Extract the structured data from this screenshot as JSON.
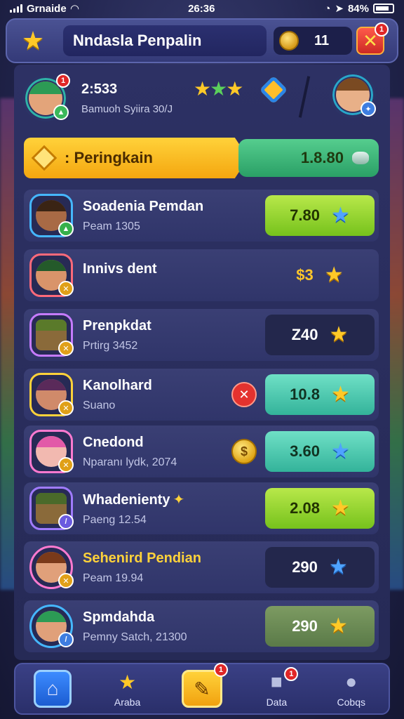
{
  "status_bar": {
    "carrier": "Grnaide",
    "time": "26:36",
    "battery_text": "84%"
  },
  "header": {
    "title": "Nndasla Penpalin",
    "coin_count": "11",
    "close_badge": "1"
  },
  "match": {
    "player_badge": "1",
    "time": "2:533",
    "subtitle": "Bamuoh Syiira 30/J",
    "stars": "★★★"
  },
  "ranking": {
    "label": ": Peringkain",
    "value": "1.8.80"
  },
  "list": [
    {
      "name": "Soadenia Pemdan",
      "sub": "Peam 1305",
      "score": "7.80",
      "star": "blue",
      "style": "green"
    },
    {
      "name": "Innivs dent",
      "sub": "",
      "score": "$3",
      "star": "gold",
      "style": "plain"
    },
    {
      "name": "Prenpkdat",
      "sub": "Prtirg 3452",
      "score": "Z40",
      "star": "gold",
      "style": "dark"
    },
    {
      "name": "Kanolhard",
      "sub": "Suano",
      "score": "10.8",
      "star": "gold",
      "style": "teal"
    },
    {
      "name": "Cnedond",
      "sub": "Nparanı lydk, 2074",
      "score": "3.60",
      "star": "blue",
      "style": "teal"
    },
    {
      "name": "Whadenienty",
      "sub": "Paeng 12.54",
      "score": "2.08",
      "star": "gold",
      "style": "green"
    },
    {
      "name": "Sehenird Pendian",
      "sub": "Peam 19.94",
      "score": "290",
      "star": "blue",
      "style": "dark"
    },
    {
      "name": "Spmdahda",
      "sub": "Pemny Satch, 21300",
      "score": "290",
      "star": "gold",
      "style": "olive"
    }
  ],
  "nav": {
    "home": "",
    "arena": "Araba",
    "center_badge": "1",
    "data": "Data",
    "data_badge": "1",
    "cobqs": "Cobqs"
  },
  "colors": {
    "accent_gold": "#ffc928",
    "accent_blue": "#4fa3ff",
    "panel": "#2d3164"
  }
}
